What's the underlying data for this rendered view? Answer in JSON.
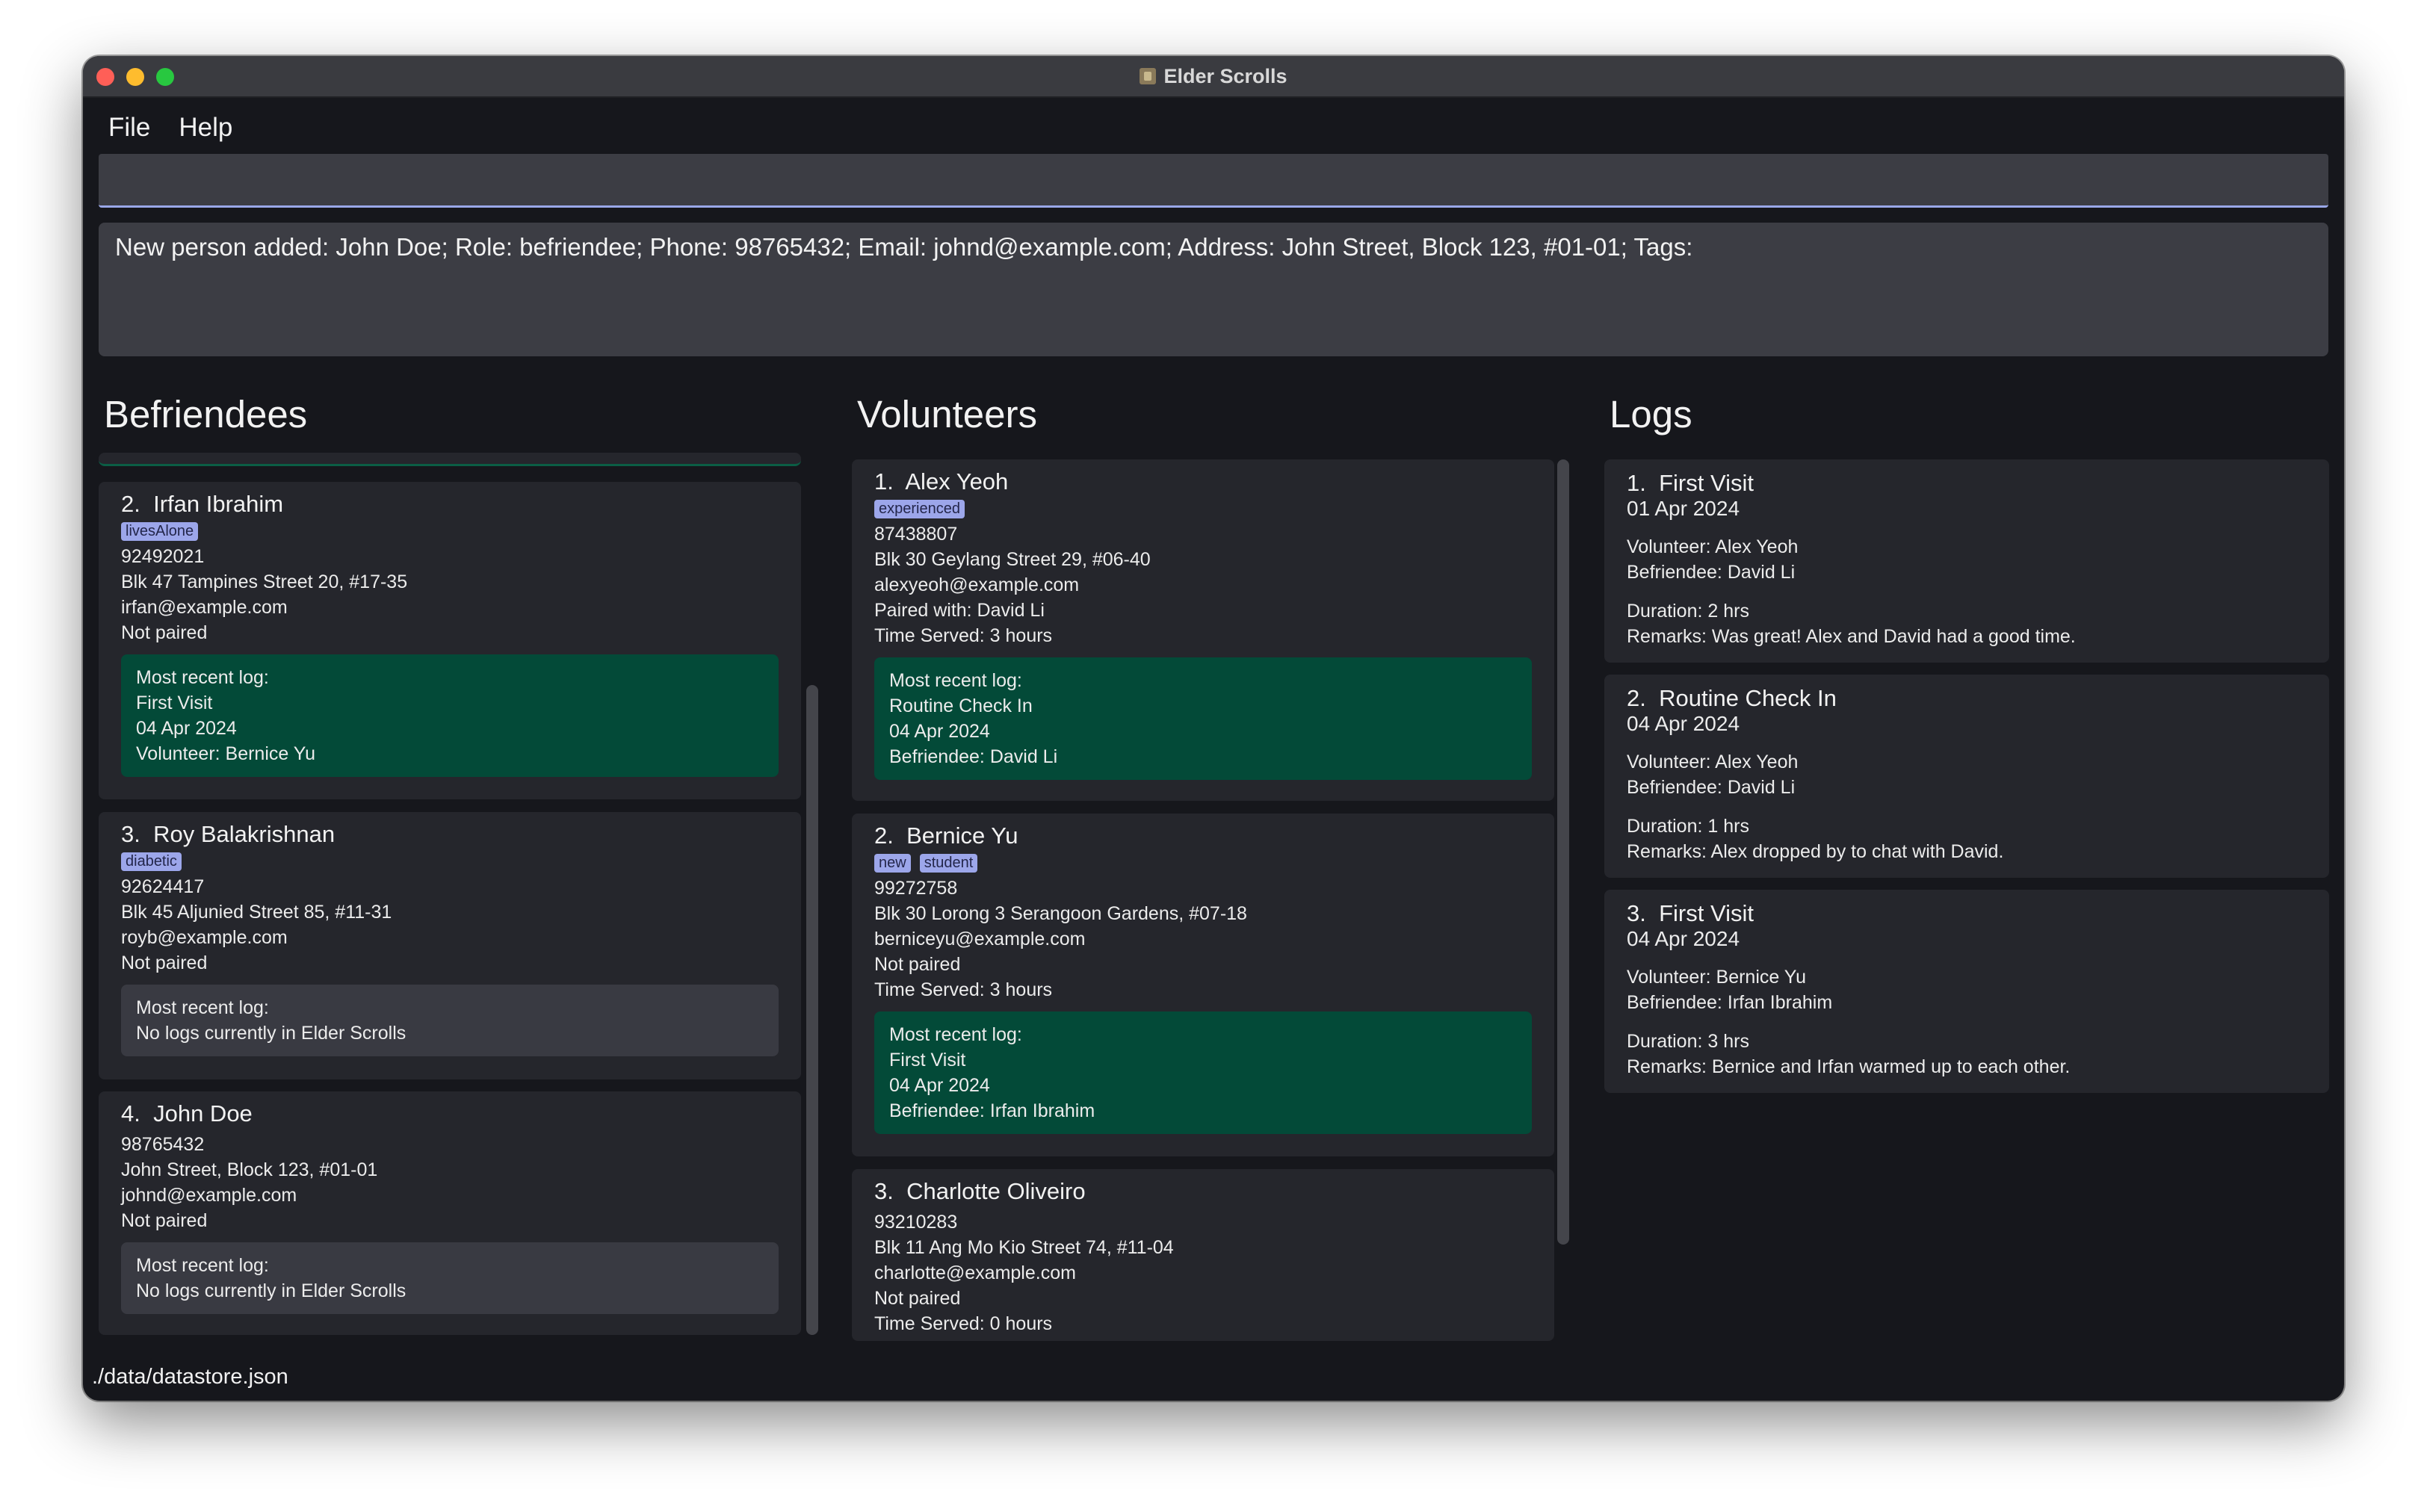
{
  "window": {
    "title": "Elder Scrolls"
  },
  "menu": {
    "file": "File",
    "help": "Help"
  },
  "command": {
    "value": ""
  },
  "result": {
    "text": "New person added: John Doe; Role: befriendee; Phone: 98765432; Email: johnd@example.com; Address: John Street, Block 123, #01-01; Tags:"
  },
  "columns": {
    "befriendees": "Befriendees",
    "volunteers": "Volunteers",
    "logs": "Logs"
  },
  "befriendees": [
    {
      "index": "2.",
      "name": "Irfan Ibrahim",
      "tags": [
        "livesAlone"
      ],
      "phone": "92492021",
      "address": "Blk 47 Tampines Street 20, #17-35",
      "email": "irfan@example.com",
      "pairing": "Not paired",
      "log": {
        "header": "Most recent log:",
        "title": "First Visit",
        "date": "04 Apr 2024",
        "person": "Volunteer: Bernice Yu"
      }
    },
    {
      "index": "3.",
      "name": "Roy Balakrishnan",
      "tags": [
        "diabetic"
      ],
      "phone": "92624417",
      "address": "Blk 45 Aljunied Street 85, #11-31",
      "email": "royb@example.com",
      "pairing": "Not paired",
      "log": {
        "header": "Most recent log:",
        "none": "No logs currently in Elder Scrolls"
      }
    },
    {
      "index": "4.",
      "name": "John Doe",
      "tags": [],
      "phone": "98765432",
      "address": "John Street, Block 123, #01-01",
      "email": "johnd@example.com",
      "pairing": "Not paired",
      "log": {
        "header": "Most recent log:",
        "none": "No logs currently in Elder Scrolls"
      }
    }
  ],
  "volunteers": [
    {
      "index": "1.",
      "name": "Alex Yeoh",
      "tags": [
        "experienced"
      ],
      "phone": "87438807",
      "address": "Blk 30 Geylang Street 29, #06-40",
      "email": "alexyeoh@example.com",
      "pairing": "Paired with: David Li",
      "time": "Time Served: 3 hours",
      "log": {
        "header": "Most recent log:",
        "title": "Routine Check In",
        "date": "04 Apr 2024",
        "person": "Befriendee: David Li"
      }
    },
    {
      "index": "2.",
      "name": "Bernice Yu",
      "tags": [
        "new",
        "student"
      ],
      "phone": "99272758",
      "address": "Blk 30 Lorong 3 Serangoon Gardens, #07-18",
      "email": "berniceyu@example.com",
      "pairing": "Not paired",
      "time": "Time Served: 3 hours",
      "log": {
        "header": "Most recent log:",
        "title": "First Visit",
        "date": "04 Apr 2024",
        "person": "Befriendee: Irfan Ibrahim"
      }
    },
    {
      "index": "3.",
      "name": "Charlotte Oliveiro",
      "tags": [],
      "phone": "93210283",
      "address": "Blk 11 Ang Mo Kio Street 74, #11-04",
      "email": "charlotte@example.com",
      "pairing": "Not paired",
      "time": "Time Served: 0 hours"
    }
  ],
  "logs": [
    {
      "index": "1.",
      "title": "First Visit",
      "date": "01 Apr 2024",
      "volunteer": "Volunteer: Alex Yeoh",
      "befriendee": "Befriendee: David Li",
      "duration": "Duration: 2 hrs",
      "remarks": "Remarks: Was great! Alex and David had a good time."
    },
    {
      "index": "2.",
      "title": "Routine Check In",
      "date": "04 Apr 2024",
      "volunteer": "Volunteer: Alex Yeoh",
      "befriendee": "Befriendee: David Li",
      "duration": "Duration: 1 hrs",
      "remarks": "Remarks: Alex dropped by to chat with David."
    },
    {
      "index": "3.",
      "title": "First Visit",
      "date": "04 Apr 2024",
      "volunteer": "Volunteer: Bernice Yu",
      "befriendee": "Befriendee: Irfan Ibrahim",
      "duration": "Duration: 3 hrs",
      "remarks": "Remarks: Bernice and Irfan warmed up to each other."
    }
  ],
  "status": {
    "path": "./data/datastore.json"
  },
  "colors": {
    "background": "#16171c",
    "card": "#25262c",
    "log_green": "#034a38",
    "tag": "#9ca6ea",
    "input": "#3c3d44"
  }
}
